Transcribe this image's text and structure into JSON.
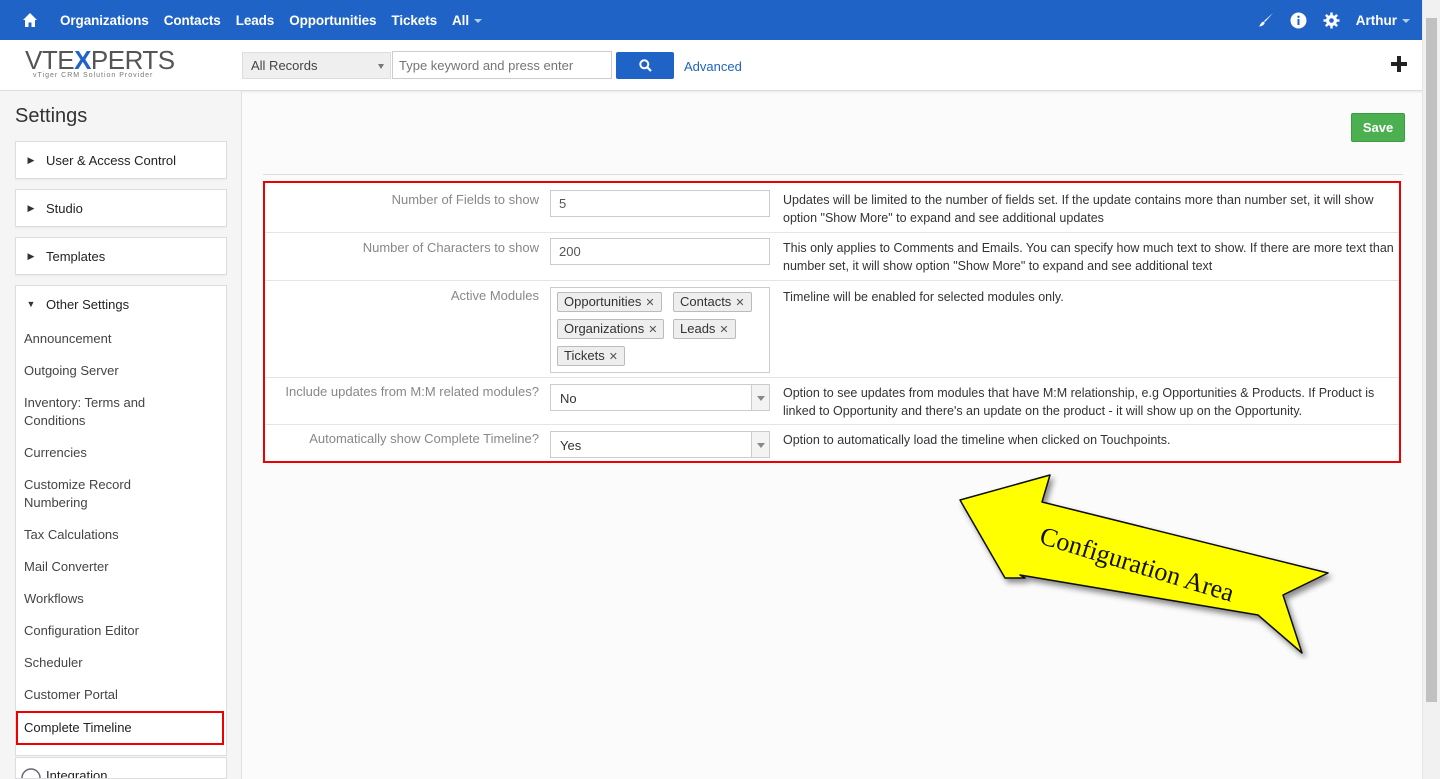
{
  "topnav": {
    "items": [
      "Organizations",
      "Contacts",
      "Leads",
      "Opportunities",
      "Tickets",
      "All"
    ],
    "user": "Arthur",
    "icons": [
      "home-icon",
      "brush-icon",
      "info-icon",
      "gear-icon"
    ]
  },
  "header": {
    "logo_brand_1": "VTE",
    "logo_brand_x": "X",
    "logo_brand_2": "PERTS",
    "logo_tagline": "vTiger CRM Solution Provider",
    "records_filter": "All Records",
    "search_placeholder": "Type keyword and press enter",
    "advanced_label": "Advanced"
  },
  "sidebar": {
    "title": "Settings",
    "accordions": [
      "User & Access Control",
      "Studio",
      "Templates",
      "Other Settings"
    ],
    "other_settings_items": [
      "Announcement",
      "Outgoing Server",
      "Inventory: Terms and Conditions",
      "Currencies",
      "Customize Record Numbering",
      "Tax Calculations",
      "Mail Converter",
      "Workflows",
      "Configuration Editor",
      "Scheduler",
      "Customer Portal"
    ],
    "active_item": "Complete Timeline",
    "next_accordion": "Integration"
  },
  "main": {
    "save_label": "Save",
    "rows": [
      {
        "label": "Number of Fields to show",
        "value": "5",
        "description": "Updates will be limited to the number of fields set. If the update contains more than number set, it will show option \"Show More\" to expand and see additional updates"
      },
      {
        "label": "Number of Characters to show",
        "value": "200",
        "description": "This only applies to Comments and Emails. You can specify how much text to show. If there are more text than number set, it will show option \"Show More\" to expand and see additional text"
      },
      {
        "label": "Active Modules",
        "modules": [
          "Opportunities",
          "Contacts",
          "Organizations",
          "Leads",
          "Tickets"
        ],
        "description": "Timeline will be enabled for selected modules only."
      },
      {
        "label": "Include updates from M:M related modules?",
        "value": "No",
        "description": "Option to see updates from modules that have M:M relationship, e.g Opportunities & Products. If Product is linked to Opportunity and there's an update on the product - it will show up on the Opportunity."
      },
      {
        "label": "Automatically show Complete Timeline?",
        "value": "Yes",
        "description": "Option to automatically load the timeline when clicked on Touchpoints."
      }
    ],
    "annotation_text": "Configuration Area"
  },
  "colors": {
    "nav_blue": "#1f63c6",
    "save_green": "#4caf50",
    "highlight_red": "#ee0000",
    "arrow_yellow": "#ffff00"
  }
}
